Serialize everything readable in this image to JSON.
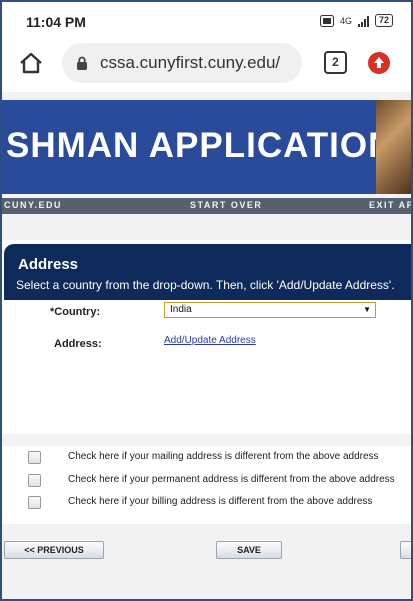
{
  "status_bar": {
    "time": "11:04 PM",
    "network": "4G",
    "battery": "72"
  },
  "browser": {
    "url": "cssa.cunyfirst.cuny.edu/",
    "tab_count": "2",
    "icons": [
      "home-icon",
      "lock-icon",
      "tabs-icon",
      "update-icon"
    ]
  },
  "banner": {
    "title": "SHMAN APPLICATION"
  },
  "nav": {
    "home_link": "CUNY.EDU",
    "start_over": "START OVER",
    "exit": "EXIT AP"
  },
  "address_section": {
    "title": "Address",
    "instruction": "Select a country from the drop-down.  Then, click 'Add/Update Address'.",
    "country_label": "*Country:",
    "country_value": "India",
    "address_label": "Address:",
    "address_link": "Add/Update Address"
  },
  "checkboxes": [
    {
      "label": "Check here if your mailing address is different from the above address",
      "checked": false
    },
    {
      "label": "Check here if your permanent address is different from the above address",
      "checked": false
    },
    {
      "label": "Check here if your billing address is different from the above address",
      "checked": false
    }
  ],
  "buttons": {
    "previous": "<< PREVIOUS",
    "save": "SAVE"
  },
  "colors": {
    "banner": "#2a4a9a",
    "header": "#0d2a5a",
    "nav": "#55626d",
    "link": "#2a3aa6"
  }
}
